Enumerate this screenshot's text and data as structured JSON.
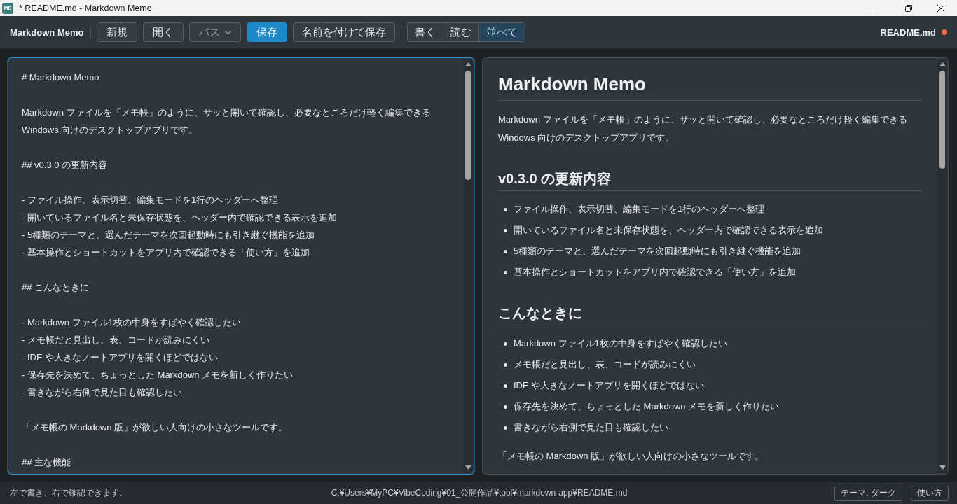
{
  "window": {
    "icon_label": "MD",
    "title": "* README.md - Markdown Memo"
  },
  "toolbar": {
    "brand": "Markdown Memo",
    "buttons": [
      {
        "label": "新規",
        "kind": "plain",
        "disabled": false
      },
      {
        "label": "開く",
        "kind": "plain",
        "disabled": false
      },
      {
        "label": "パス",
        "kind": "dropdown",
        "disabled": true
      },
      {
        "label": "保存",
        "kind": "primary",
        "disabled": false
      },
      {
        "label": "名前を付けて保存",
        "kind": "plain",
        "disabled": false
      }
    ],
    "view_modes": [
      {
        "label": "書く",
        "selected": false
      },
      {
        "label": "読む",
        "selected": false
      },
      {
        "label": "並べて",
        "selected": true
      }
    ],
    "file": {
      "name": "README.md",
      "unsaved": true
    }
  },
  "editor": {
    "focused": true,
    "blocks": [
      [
        "# Markdown Memo"
      ],
      [
        "Markdown ファイルを「メモ帳」のように、サッと開いて確認し、必要なところだけ軽く編集できる",
        "Windows 向けのデスクトップアプリです。"
      ],
      [
        "## v0.3.0 の更新内容"
      ],
      [
        "- ファイル操作、表示切替、編集モードを1行のヘッダーへ整理",
        "- 開いているファイル名と未保存状態を、ヘッダー内で確認できる表示を追加",
        "- 5種類のテーマと、選んだテーマを次回起動時にも引き継ぐ機能を追加",
        "- 基本操作とショートカットをアプリ内で確認できる「使い方」を追加"
      ],
      [
        "## こんなときに"
      ],
      [
        "- Markdown ファイル1枚の中身をすばやく確認したい",
        "- メモ帳だと見出し、表、コードが読みにくい",
        "- IDE や大きなノートアプリを開くほどではない",
        "- 保存先を決めて、ちょっとした Markdown メモを新しく作りたい",
        "- 書きながら右側で見た目も確認したい"
      ],
      [
        "「メモ帳の Markdown 版」が欲しい人向けの小さなツールです。"
      ],
      [
        "## 主な機能"
      ]
    ]
  },
  "preview": {
    "blocks": [
      {
        "kind": "h1",
        "text": "Markdown Memo"
      },
      {
        "kind": "p",
        "lines": [
          "Markdown ファイルを「メモ帳」のように、サッと開いて確認し、必要なところだけ軽く編集できる",
          "Windows 向けのデスクトップアプリです。"
        ]
      },
      {
        "kind": "h2",
        "text": "v0.3.0 の更新内容"
      },
      {
        "kind": "ul",
        "items": [
          "ファイル操作、表示切替、編集モードを1行のヘッダーへ整理",
          "開いているファイル名と未保存状態を、ヘッダー内で確認できる表示を追加",
          "5種類のテーマと、選んだテーマを次回起動時にも引き継ぐ機能を追加",
          "基本操作とショートカットをアプリ内で確認できる「使い方」を追加"
        ]
      },
      {
        "kind": "h2",
        "text": "こんなときに"
      },
      {
        "kind": "ul",
        "items": [
          "Markdown ファイル1枚の中身をすばやく確認したい",
          "メモ帳だと見出し、表、コードが読みにくい",
          "IDE や大きなノートアプリを開くほどではない",
          "保存先を決めて、ちょっとした Markdown メモを新しく作りたい",
          "書きながら右側で見た目も確認したい"
        ]
      },
      {
        "kind": "p",
        "lines": [
          "「メモ帳の Markdown 版」が欲しい人向けの小さなツールです。"
        ]
      }
    ]
  },
  "status_bar": {
    "hint": "左で書き、右で確認できます。",
    "path": "C:¥Users¥MyPC¥VibeCoding¥01_公開作品¥tool¥markdown-app¥README.md",
    "buttons": [
      "テーマ: ダーク",
      "使い方"
    ]
  }
}
